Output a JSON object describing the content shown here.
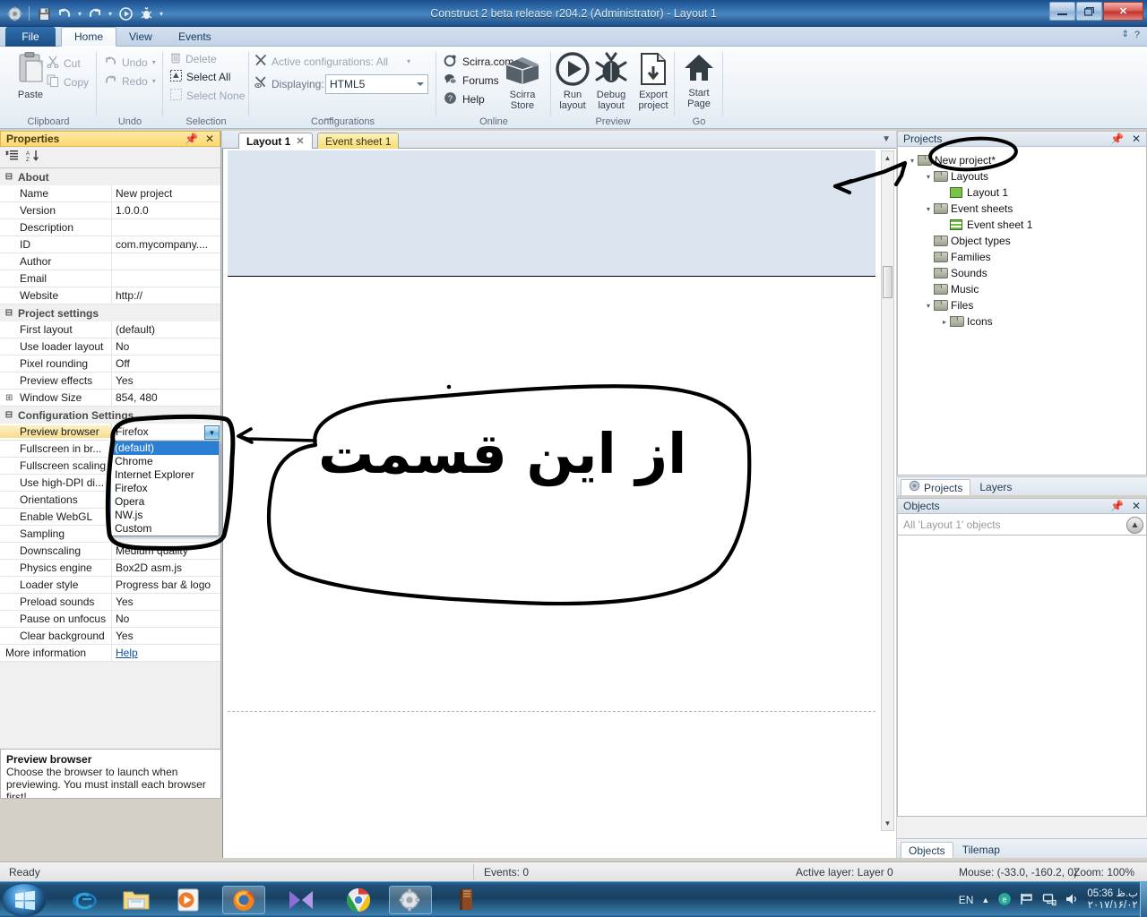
{
  "window": {
    "title": "Construct 2 beta release r204.2 (Administrator) - Layout 1",
    "minimize": "—",
    "maximize": "❐",
    "close": "✕"
  },
  "quick_access": {
    "app_icon": "construct2-icon",
    "save": "save-icon",
    "undo": "undo-icon",
    "redo": "redo-icon",
    "run": "run-icon",
    "debug": "debug-icon",
    "more": "▾"
  },
  "ribbon": {
    "tabs": [
      {
        "label": "File",
        "active": false
      },
      {
        "label": "Home",
        "active": true
      },
      {
        "label": "View",
        "active": false
      },
      {
        "label": "Events",
        "active": false
      }
    ],
    "groups": [
      {
        "name": "Clipboard",
        "label": "Clipboard",
        "big": [
          {
            "label": "Paste",
            "icon": "paste-icon"
          }
        ],
        "small": [
          {
            "label": "Cut",
            "icon": "cut-icon",
            "enabled": false
          },
          {
            "label": "Copy",
            "icon": "copy-icon",
            "enabled": false
          }
        ]
      },
      {
        "name": "Undo",
        "label": "Undo",
        "small": [
          {
            "label": "Undo",
            "icon": "undo-icon",
            "enabled": false,
            "dropdown": true
          },
          {
            "label": "Redo",
            "icon": "redo-icon",
            "enabled": false,
            "dropdown": true
          }
        ]
      },
      {
        "name": "Selection",
        "label": "Selection",
        "small": [
          {
            "label": "Delete",
            "icon": "trash-icon",
            "enabled": false
          },
          {
            "label": "Select All",
            "icon": "select-all-icon",
            "enabled": true
          },
          {
            "label": "Select None",
            "icon": "select-none-icon",
            "enabled": false
          }
        ]
      },
      {
        "name": "Configurations",
        "label": "Configurations",
        "rows": [
          {
            "label": "Active configurations: All",
            "icon": "wrench-icon"
          },
          {
            "label": "Displaying:",
            "icon": "wrench-eye-icon",
            "value": "HTML5"
          }
        ]
      },
      {
        "name": "Online",
        "label": "Online",
        "links": [
          {
            "label": "Scirra.com",
            "icon": "scirra-icon"
          },
          {
            "label": "Forums",
            "icon": "forums-icon"
          },
          {
            "label": "Help",
            "icon": "help-icon"
          }
        ],
        "big": [
          {
            "label": "Scirra\nStore",
            "line1": "Scirra",
            "line2": "Store",
            "icon": "store-icon"
          }
        ]
      },
      {
        "name": "Preview",
        "label": "Preview",
        "big": [
          {
            "line1": "Run",
            "line2": "layout",
            "icon": "play-icon"
          },
          {
            "line1": "Debug",
            "line2": "layout",
            "icon": "bug-icon"
          },
          {
            "line1": "Export",
            "line2": "project",
            "icon": "export-icon"
          }
        ]
      },
      {
        "name": "Go",
        "label": "Go",
        "big": [
          {
            "line1": "Start",
            "line2": "Page",
            "icon": "home-icon"
          }
        ]
      }
    ]
  },
  "properties": {
    "title": "Properties",
    "pin": "pin-icon",
    "close": "✕",
    "toolbar": [
      "categorize-icon",
      "sort-alpha-icon"
    ],
    "sections": [
      {
        "name": "About",
        "rows": [
          {
            "key": "Name",
            "value": "New project"
          },
          {
            "key": "Version",
            "value": "1.0.0.0"
          },
          {
            "key": "Description",
            "value": ""
          },
          {
            "key": "ID",
            "value": "com.mycompany...."
          },
          {
            "key": "Author",
            "value": ""
          },
          {
            "key": "Email",
            "value": ""
          },
          {
            "key": "Website",
            "value": "http://"
          }
        ]
      },
      {
        "name": "Project settings",
        "rows": [
          {
            "key": "First layout",
            "value": "(default)"
          },
          {
            "key": "Use loader layout",
            "value": "No"
          },
          {
            "key": "Pixel rounding",
            "value": "Off"
          },
          {
            "key": "Preview effects",
            "value": "Yes"
          },
          {
            "key": "Window Size",
            "value": "854, 480",
            "expandable": true
          }
        ]
      },
      {
        "name": "Configuration Settings",
        "rows": [
          {
            "key": "Preview browser",
            "value": "Firefox",
            "selected": true
          },
          {
            "key": "Fullscreen in br...",
            "value": ""
          },
          {
            "key": "Fullscreen scaling",
            "value": ""
          },
          {
            "key": "Use high-DPI di...",
            "value": ""
          },
          {
            "key": "Orientations",
            "value": ""
          },
          {
            "key": "Enable WebGL",
            "value": ""
          },
          {
            "key": "Sampling",
            "value": ""
          },
          {
            "key": "Downscaling",
            "value": "Medium quality"
          },
          {
            "key": "Physics engine",
            "value": "Box2D asm.js"
          },
          {
            "key": "Loader style",
            "value": "Progress bar & logo"
          },
          {
            "key": "Preload sounds",
            "value": "Yes"
          },
          {
            "key": "Pause on unfocus",
            "value": "No"
          },
          {
            "key": "Clear background",
            "value": "Yes"
          }
        ]
      }
    ],
    "more_info": {
      "key": "More information",
      "value": "Help"
    },
    "description": {
      "title": "Preview browser",
      "text": "Choose the browser to launch when previewing.  You must install each browser first!"
    }
  },
  "browser_dropdown": {
    "open": true,
    "selected_value": "Firefox",
    "highlighted": "(default)",
    "options": [
      "(default)",
      "Chrome",
      "Internet Explorer",
      "Firefox",
      "Opera",
      "NW.js",
      "Custom"
    ]
  },
  "view": {
    "tabs": [
      {
        "label": "Layout 1",
        "active": true,
        "closable": true
      },
      {
        "label": "Event sheet 1",
        "active": false,
        "closable": false
      }
    ],
    "collapse_icon": "chevron-down-icon"
  },
  "projects_panel": {
    "title": "Projects",
    "pin": "pin-icon",
    "close": "✕",
    "tree": [
      {
        "label": "New project*",
        "depth": 0,
        "icon": "folder-icon",
        "twisty": "▾"
      },
      {
        "label": "Layouts",
        "depth": 1,
        "icon": "folder-icon",
        "twisty": "▾"
      },
      {
        "label": "Layout 1",
        "depth": 2,
        "icon": "layout-icon",
        "twisty": ""
      },
      {
        "label": "Event sheets",
        "depth": 1,
        "icon": "folder-icon",
        "twisty": "▾"
      },
      {
        "label": "Event sheet 1",
        "depth": 2,
        "icon": "eventsheet-icon",
        "twisty": ""
      },
      {
        "label": "Object types",
        "depth": 1,
        "icon": "folder-icon",
        "twisty": ""
      },
      {
        "label": "Families",
        "depth": 1,
        "icon": "folder-icon",
        "twisty": ""
      },
      {
        "label": "Sounds",
        "depth": 1,
        "icon": "folder-icon",
        "twisty": ""
      },
      {
        "label": "Music",
        "depth": 1,
        "icon": "folder-icon",
        "twisty": ""
      },
      {
        "label": "Files",
        "depth": 1,
        "icon": "folder-icon",
        "twisty": "▾"
      },
      {
        "label": "Icons",
        "depth": 2,
        "icon": "folder-icon",
        "twisty": "▸"
      }
    ],
    "bottom_tabs": [
      {
        "label": "Projects",
        "active": true,
        "icon": "projects-icon"
      },
      {
        "label": "Layers",
        "active": false
      }
    ]
  },
  "objects_panel": {
    "title": "Objects",
    "pin": "pin-icon",
    "close": "✕",
    "search_placeholder": "All 'Layout 1' objects",
    "up_button": "up-arrow-icon",
    "bottom_tabs": [
      {
        "label": "Objects",
        "active": true
      },
      {
        "label": "Tilemap",
        "active": false
      }
    ]
  },
  "statusbar": {
    "ready": "Ready",
    "events": "Events: 0",
    "active_layer": "Active layer: Layer 0",
    "mouse": "Mouse: (-33.0, -160.2, 0)",
    "zoom": "Zoom: 100%"
  },
  "taskbar": {
    "start": "start-orb",
    "items": [
      {
        "name": "internet-explorer-icon",
        "running": false
      },
      {
        "name": "file-explorer-icon",
        "running": false
      },
      {
        "name": "windows-media-player-icon",
        "running": false
      },
      {
        "name": "firefox-icon",
        "running": true
      },
      {
        "name": "movie-maker-icon",
        "running": false
      },
      {
        "name": "chrome-icon",
        "running": false
      },
      {
        "name": "construct2-icon",
        "running": true
      },
      {
        "name": "book-icon",
        "running": false
      }
    ],
    "tray": {
      "language": "EN",
      "show_hidden": "▲",
      "icons": [
        "antivirus-icon",
        "flag-icon",
        "network-icon",
        "volume-icon"
      ],
      "time": "05:36 ب.ظ",
      "date": "۲۰۱۷/۱۶/۰۲"
    }
  },
  "annotations": {
    "persian_note": "از این قسمت",
    "circle_project_node": "handdrawn-circle",
    "arrow_to_project": "handdrawn-arrow",
    "arrow_to_dropdown": "handdrawn-arrow",
    "circle_dropdown": "handdrawn-circle"
  }
}
